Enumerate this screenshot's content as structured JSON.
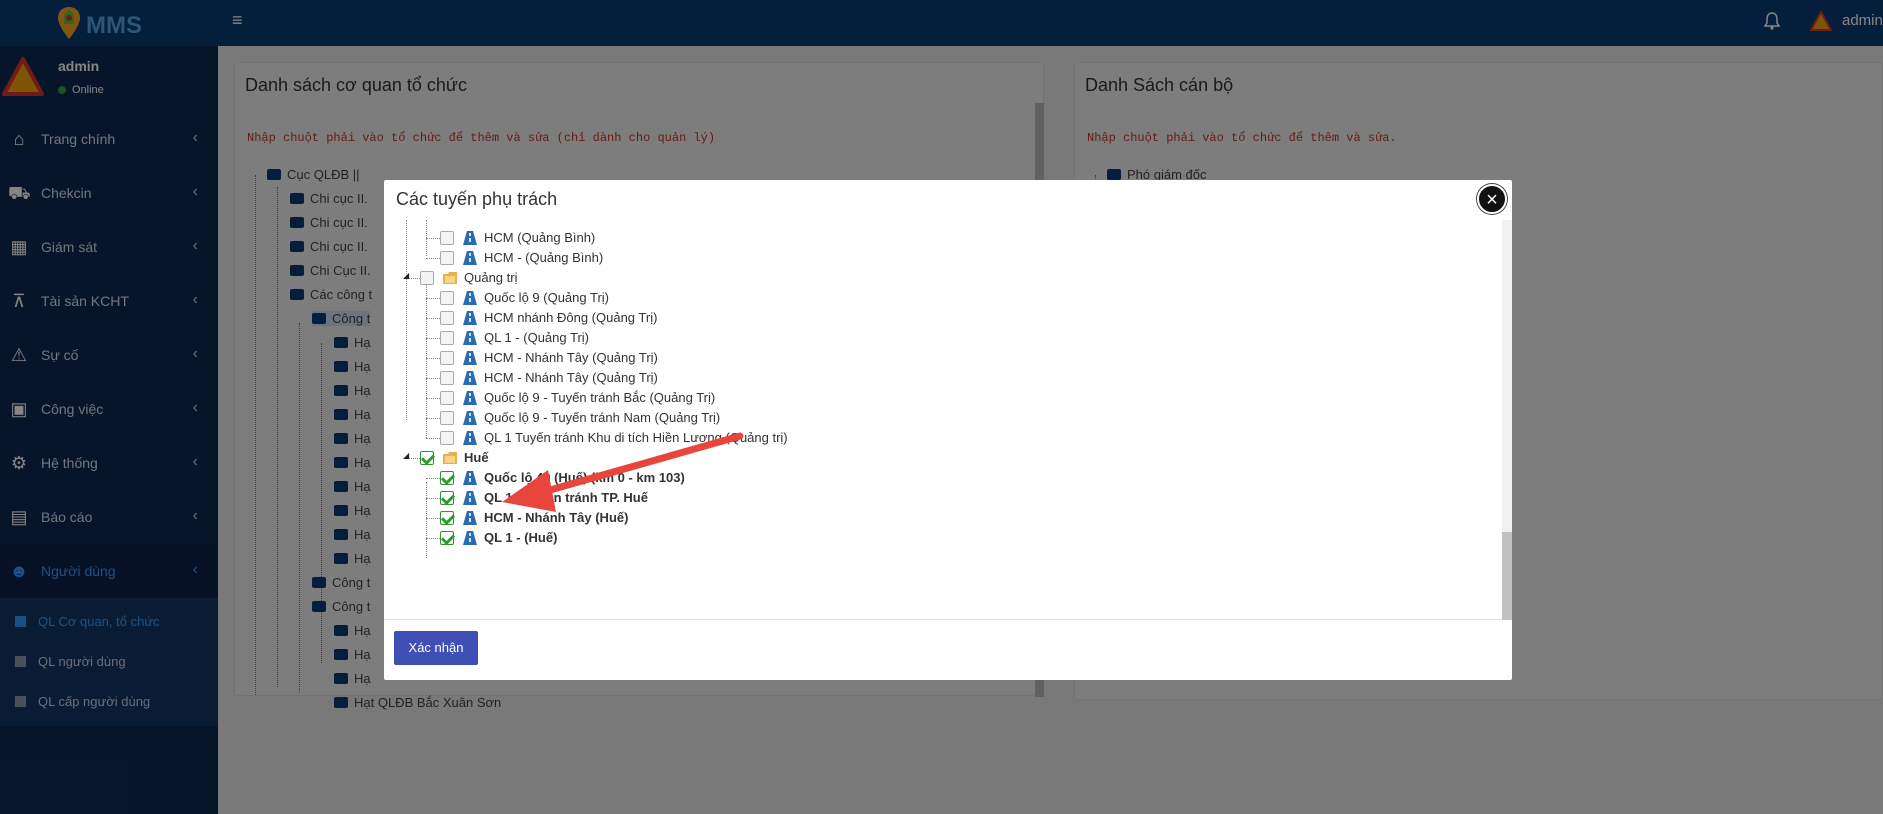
{
  "app": {
    "logo_text": "MMS",
    "top_user": "admin"
  },
  "sidebar": {
    "user": {
      "name": "admin",
      "status": "Online"
    },
    "items": [
      {
        "label": "Trang chính",
        "icon": "home-icon"
      },
      {
        "label": "Chekcin",
        "icon": "truck-icon"
      },
      {
        "label": "Giám sát",
        "icon": "map-icon"
      },
      {
        "label": "Tài sản KCHT",
        "icon": "road-barrier-icon"
      },
      {
        "label": "Sự cố",
        "icon": "crash-icon"
      },
      {
        "label": "Công việc",
        "icon": "briefcase-icon"
      },
      {
        "label": "Hệ thống",
        "icon": "gears-icon"
      },
      {
        "label": "Báo cáo",
        "icon": "table-icon"
      },
      {
        "label": "Người dùng",
        "icon": "users-icon"
      }
    ],
    "subitems": [
      {
        "label": "QL Cơ quan, tổ chức",
        "active": true
      },
      {
        "label": "QL người dùng",
        "active": false
      },
      {
        "label": "QL cấp người dùng",
        "active": false
      }
    ]
  },
  "left_panel": {
    "title": "Danh sách cơ quan tổ chức",
    "hint": "Nhập chuột phải vào tổ chức để thêm và sửa (chỉ dành cho quản lý)",
    "nodes": [
      "Cục QLĐB ||",
      "Chi cục II.",
      "Chi cục II.",
      "Chi cục II.",
      "Chi Cục II.",
      "Các công t",
      "Công t",
      "Hạ",
      "Hạ",
      "Hạ",
      "Hạ",
      "Hạ",
      "Hạ",
      "Hạ",
      "Hạ",
      "Hạ",
      "Hạ",
      "Công t",
      "Công t",
      "Hạ",
      "Hạ",
      "Hạ",
      "Hạt QLĐB Bắc Xuân Sơn"
    ]
  },
  "right_panel": {
    "title": "Danh Sách cán bộ",
    "hint": "Nhập chuột phải vào tổ chức để thêm và sửa.",
    "nodes": [
      "Phó giám đốc"
    ]
  },
  "modal": {
    "title": "Các tuyến phụ trách",
    "close_label": "×",
    "confirm_label": "Xác nhận",
    "rows": [
      {
        "label": "HCM (Quảng Bình)",
        "checked": false,
        "type": "road"
      },
      {
        "label": "HCM - (Quảng Bình)",
        "checked": false,
        "type": "road"
      },
      {
        "label": "Quảng trị",
        "checked": false,
        "type": "folder"
      },
      {
        "label": "Quốc lộ 9 (Quảng Trị)",
        "checked": false,
        "type": "road"
      },
      {
        "label": "HCM nhánh Đông (Quảng Trị)",
        "checked": false,
        "type": "road"
      },
      {
        "label": "QL 1 - (Quảng Trị)",
        "checked": false,
        "type": "road"
      },
      {
        "label": "HCM - Nhánh Tây (Quảng Trị)",
        "checked": false,
        "type": "road"
      },
      {
        "label": "HCM - Nhánh Tây (Quảng Trị)",
        "checked": false,
        "type": "road"
      },
      {
        "label": "Quốc lộ 9 - Tuyến tránh Bắc (Quảng Trị)",
        "checked": false,
        "type": "road"
      },
      {
        "label": "Quốc lộ 9 - Tuyến tránh Nam (Quảng Trị)",
        "checked": false,
        "type": "road"
      },
      {
        "label": "QL 1 Tuyến tránh Khu di tích Hiền Lương (Quảng trị)",
        "checked": false,
        "type": "road"
      },
      {
        "label": "Huế",
        "checked": true,
        "type": "folder"
      },
      {
        "label": "Quốc lộ 49 (Huế) (km 0 - km 103)",
        "checked": true,
        "type": "road"
      },
      {
        "label": "QL 1 - Tuyến tránh TP. Huế",
        "checked": true,
        "type": "road"
      },
      {
        "label": "HCM - Nhánh Tây (Huế)",
        "checked": true,
        "type": "road"
      },
      {
        "label": "QL 1 - (Huế)",
        "checked": true,
        "type": "road"
      }
    ]
  },
  "colors": {
    "topbar": "#0b3a73",
    "sidebar": "#0e2a52",
    "accent": "#3b9cff",
    "confirm": "#3f4fb5",
    "arrow": "#e8453c"
  }
}
